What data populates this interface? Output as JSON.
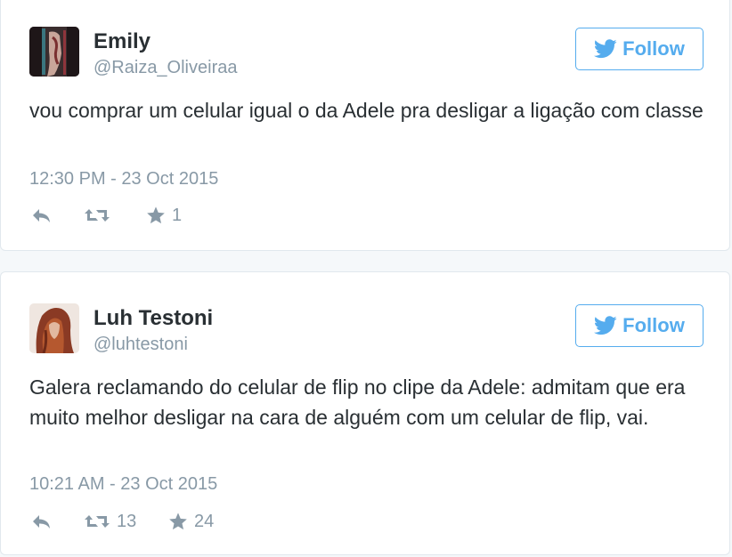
{
  "accent_color": "#55acee",
  "tweets": [
    {
      "name": "Emily",
      "handle": "@Raiza_Oliveiraa",
      "follow_label": "Follow",
      "text": "vou comprar um celular igual o da Adele pra desligar a ligação com classe",
      "timestamp": "12:30 PM - 23 Oct 2015",
      "reply_icon": "reply-icon",
      "retweet_icon": "retweet-icon",
      "retweet_count": "",
      "like_icon": "star-icon",
      "like_count": "1"
    },
    {
      "name": "Luh Testoni",
      "handle": "@luhtestoni",
      "follow_label": "Follow",
      "text": "Galera reclamando do celular de flip no clipe da Adele: admitam que era muito melhor desligar na cara de alguém com um celular de flip, vai.",
      "timestamp": "10:21 AM - 23 Oct 2015",
      "reply_icon": "reply-icon",
      "retweet_icon": "retweet-icon",
      "retweet_count": "13",
      "like_icon": "star-icon",
      "like_count": "24"
    }
  ]
}
